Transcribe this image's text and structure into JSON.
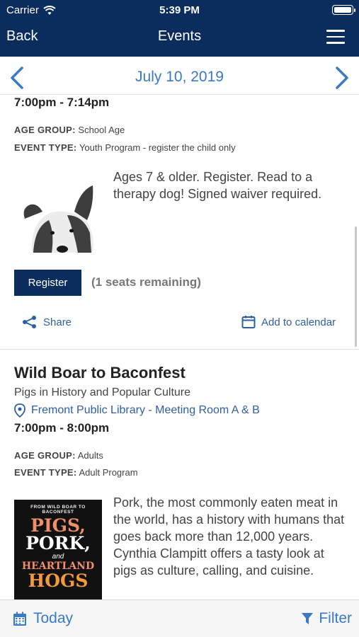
{
  "status": {
    "carrier": "Carrier",
    "time": "5:39 PM"
  },
  "nav": {
    "back_label": "Back",
    "title": "Events"
  },
  "datebar": {
    "date": "July 10, 2019"
  },
  "event1": {
    "time": "7:00pm - 7:14pm",
    "age_group_label": "AGE GROUP:",
    "age_group_value": "School Age",
    "event_type_label": "EVENT TYPE:",
    "event_type_value": "Youth Program - register the child only",
    "description": "Ages 7 & older. Register. Read to a therapy dog! Signed waiver required.",
    "register_label": "Register",
    "seats": "(1 seats remaining)",
    "share_label": "Share",
    "calendar_label": "Add to calendar"
  },
  "event2": {
    "title": "Wild Boar to Baconfest",
    "subtitle": "Pigs in History and Popular Culture",
    "location": "Fremont Public Library - Meeting Room A & B",
    "time": "7:00pm - 8:00pm",
    "age_group_label": "AGE GROUP:",
    "age_group_value": "Adults",
    "event_type_label": "EVENT TYPE:",
    "event_type_value": "Adult Program",
    "description": "Pork, the most commonly eaten meat in the world, has a history with humans that goes back more than 12,000 years. Cynthia Clampitt offers a tasty look at pigs as culture, calling, and cuisine.",
    "cover": {
      "top": "FROM WILD BOAR TO BACONFEST",
      "w1": "PIGS,",
      "w2": "PORK,",
      "w3": "and",
      "w4": "HEARTLAND",
      "w5": "HOGS"
    }
  },
  "bottom": {
    "today_label": "Today",
    "filter_label": "Filter"
  },
  "colors": {
    "navy": "#0a2d5e",
    "link_blue": "#3a79c6",
    "action_blue": "#2f5fa3"
  }
}
